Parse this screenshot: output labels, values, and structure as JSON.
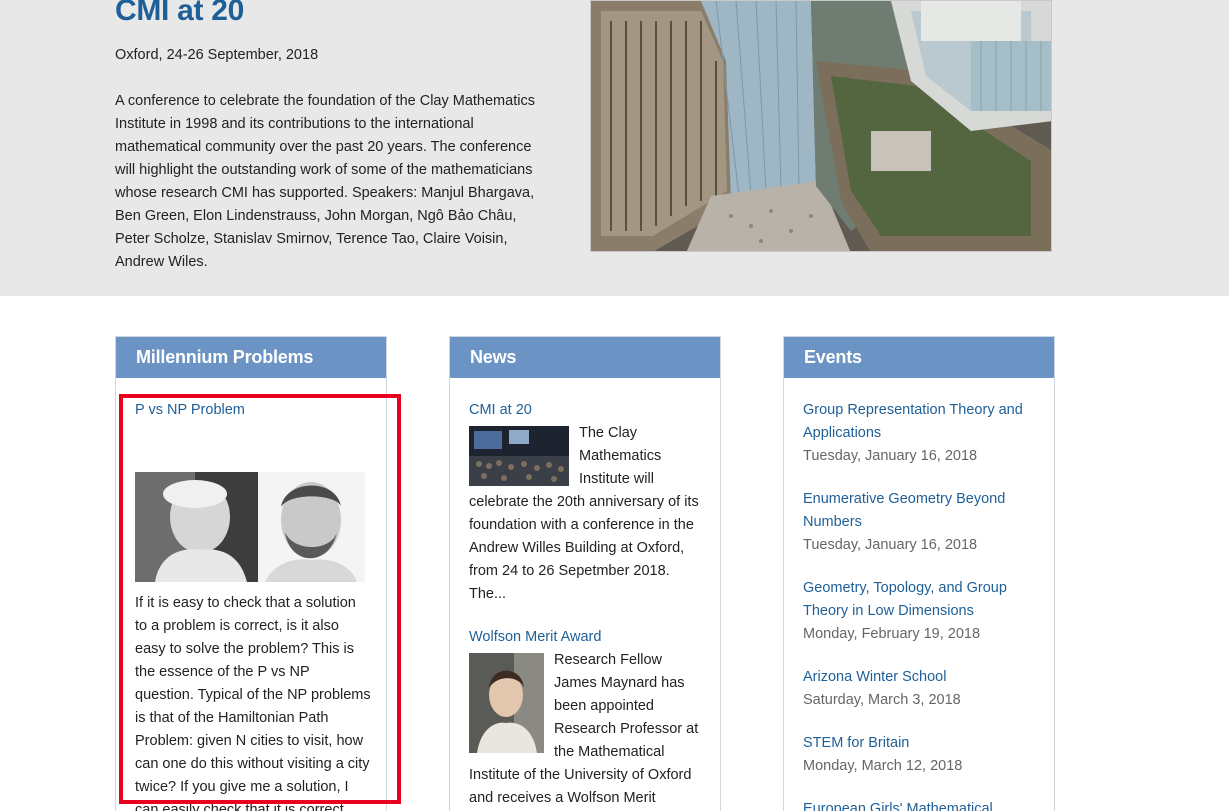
{
  "hero": {
    "title": "CMI at 20",
    "date": "Oxford, 24-26 September, 2018",
    "description": "A conference to celebrate the foundation of the Clay Mathematics Institute in 1998 and its contributions to the international mathematical community over the past 20 years. The conference will highlight the outstanding work of some of the mathematicians whose research CMI has supported. Speakers: Manjul Bhargava, Ben Green, Elon Lindenstrauss, John Morgan, Ngô Bảo Châu, Peter Scholze, Stanislav Smirnov, Terence Tao, Claire Voisin, Andrew Wiles."
  },
  "millennium": {
    "header": "Millennium Problems",
    "problem_title": "P vs NP Problem",
    "problem_text": "If it is easy to check that a solution to a problem is correct, is it also easy to solve the problem? This is the essence of the P vs NP question. Typical of the NP problems is that of the Hamiltonian Path Problem: given N cities to visit, how can one do this without visiting a city twice? If you give me a solution, I can easily check that it is correct. But I cannot so easily find a solution."
  },
  "news": {
    "header": "News",
    "items": [
      {
        "title": "CMI at 20",
        "text": "The Clay Mathematics Institute will celebrate the 20th anniversary of its foundation with a conference  in the Andrew Willes Building at Oxford, from 24 to 26 Sepetmber 2018.  The..."
      },
      {
        "title": "Wolfson Merit Award",
        "text": "Research Fellow James Maynard has been appointed Research Professor at the Mathematical Institute of the University of Oxford and receives a Wolfson Merit"
      }
    ]
  },
  "events": {
    "header": "Events",
    "items": [
      {
        "title": "Group Representation Theory and Applications",
        "date": "Tuesday, January 16, 2018"
      },
      {
        "title": "Enumerative Geometry Beyond Numbers",
        "date": "Tuesday, January 16, 2018"
      },
      {
        "title": "Geometry, Topology, and Group Theory in Low Dimensions",
        "date": "Monday, February 19, 2018"
      },
      {
        "title": "Arizona Winter School",
        "date": "Saturday, March 3, 2018"
      },
      {
        "title": "STEM for Britain",
        "date": "Monday, March 12, 2018"
      },
      {
        "title": "European Girls' Mathematical",
        "date": ""
      }
    ]
  },
  "colors": {
    "link": "#1f5f98",
    "panel_header": "#6b93c3",
    "highlight": "#e8001c",
    "hero_bg": "#e8e8e8"
  }
}
